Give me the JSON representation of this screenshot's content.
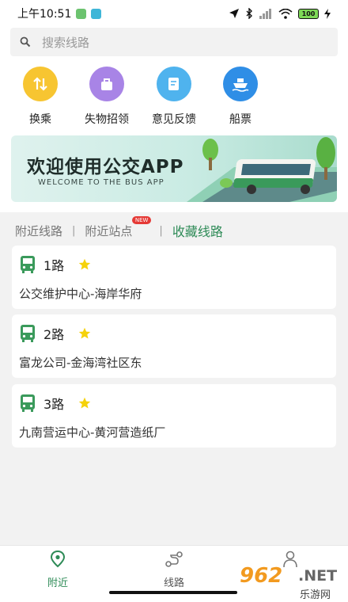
{
  "status_bar": {
    "time": "上午10:51",
    "battery": "100"
  },
  "search": {
    "placeholder": "搜索线路"
  },
  "quick_actions": [
    {
      "label": "换乘",
      "icon": "transfer-icon",
      "color": "#f7c531"
    },
    {
      "label": "失物招领",
      "icon": "lost-found-icon",
      "color": "#a884e6"
    },
    {
      "label": "意见反馈",
      "icon": "feedback-icon",
      "color": "#4fb3ee"
    },
    {
      "label": "船票",
      "icon": "ship-icon",
      "color": "#2f8ee6"
    }
  ],
  "banner": {
    "title": "欢迎使用公交APP",
    "subtitle": "WELCOME TO THE BUS APP"
  },
  "tabs": [
    {
      "label": "附近线路",
      "active": false
    },
    {
      "label": "附近站点",
      "active": false,
      "badge": "NEW"
    },
    {
      "label": "收藏线路",
      "active": true
    }
  ],
  "routes": [
    {
      "name": "1路",
      "stops": "公交维护中心-海岸华府"
    },
    {
      "name": "2路",
      "stops": "富龙公司-金海湾社区东"
    },
    {
      "name": "3路",
      "stops": "九南营运中心-黄河营造纸厂"
    }
  ],
  "bottom_nav": [
    {
      "label": "附近",
      "icon": "location-pin-icon",
      "active": true
    },
    {
      "label": "线路",
      "icon": "route-icon",
      "active": false
    },
    {
      "label": "",
      "icon": "user-icon",
      "active": false
    }
  ],
  "watermark": {
    "number": "962",
    "domain": ".NET",
    "text": "乐游网"
  },
  "colors": {
    "accent": "#2e8b57",
    "bus_green": "#3a9a5b",
    "star": "#f5d20a"
  }
}
